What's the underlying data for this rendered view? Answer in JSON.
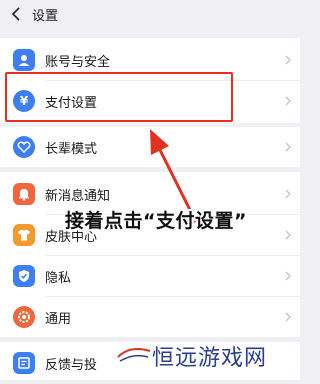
{
  "header": {
    "title": "设置"
  },
  "items": [
    {
      "label": "账号与安全",
      "icon": "person-icon",
      "color": "#3d7ff0"
    },
    {
      "label": "支付设置",
      "icon": "yen-icon",
      "color": "#3d7ff0"
    },
    {
      "label": "长辈模式",
      "icon": "heart-icon",
      "color": "#3d7ff0"
    },
    {
      "label": "新消息通知",
      "icon": "bell-icon",
      "color": "#f0663d"
    },
    {
      "label": "皮肤中心",
      "icon": "shirt-icon",
      "color": "#f39a2e"
    },
    {
      "label": "隐私",
      "icon": "shield-check-icon",
      "color": "#3d7ff0"
    },
    {
      "label": "通用",
      "icon": "gear-icon",
      "color": "#f0663d"
    },
    {
      "label": "反馈与投",
      "icon": "feedback-icon",
      "color": "#3d7ff0"
    }
  ],
  "annotation": {
    "text": "接着点击“支付设置”",
    "highlight_color": "#e3311f"
  },
  "watermark": {
    "text": "恒远游戏网"
  }
}
